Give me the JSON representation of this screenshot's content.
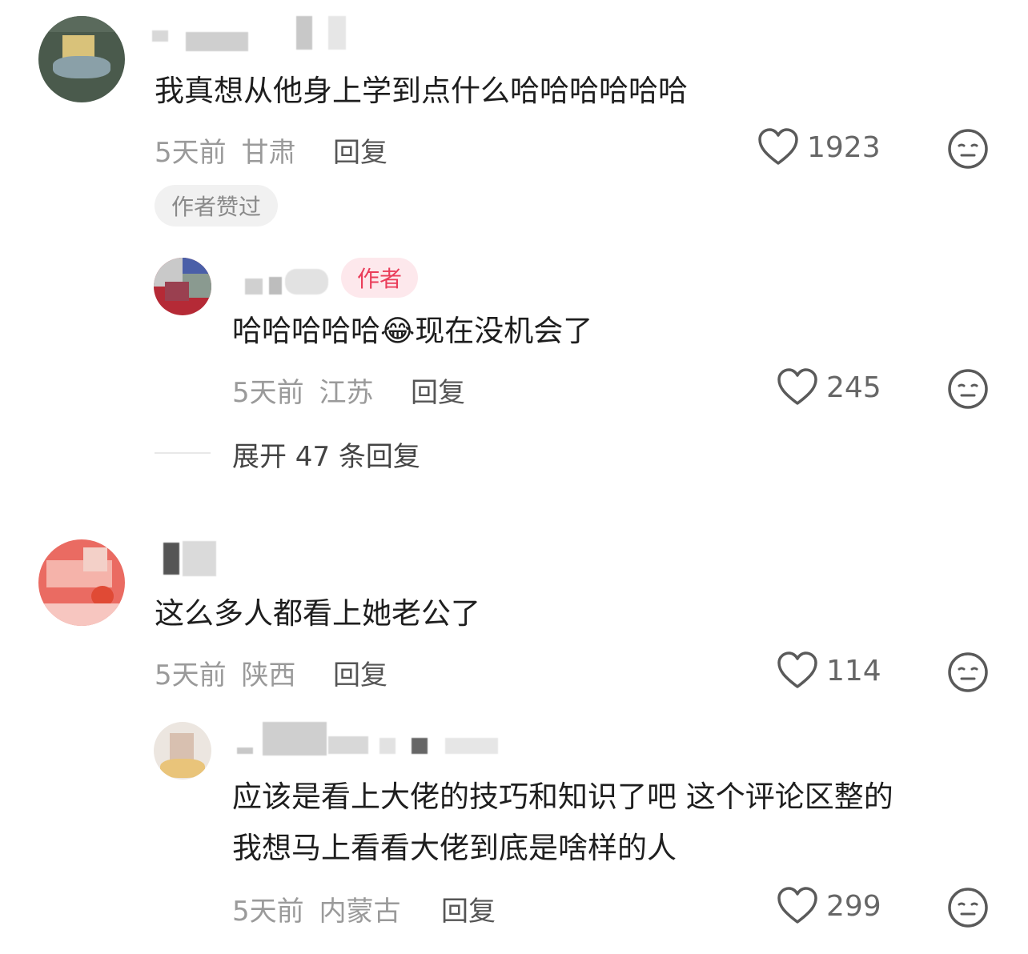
{
  "comments": [
    {
      "text": "我真想从他身上学到点什么哈哈哈哈哈哈",
      "time": "5天前",
      "location": "甘肃",
      "reply_label": "回复",
      "likes": "1923",
      "liked_badge": "作者赞过",
      "replies": [
        {
          "author_badge": "作者",
          "text": "哈哈哈哈哈😂现在没机会了",
          "time": "5天前",
          "location": "江苏",
          "reply_label": "回复",
          "likes": "245"
        }
      ],
      "expand_label": "展开 47 条回复"
    },
    {
      "text": "这么多人都看上她老公了",
      "time": "5天前",
      "location": "陕西",
      "reply_label": "回复",
      "likes": "114",
      "replies": [
        {
          "text_line1": "应该是看上大佬的技巧和知识了吧 这个评论区整的",
          "text_line2": "我想马上看看大佬到底是啥样的人",
          "time": "5天前",
          "location": "内蒙古",
          "reply_label": "回复",
          "likes": "299"
        }
      ]
    }
  ],
  "icons": {
    "like": "heart-outline-icon",
    "dislike": "meh-face-icon"
  },
  "colors": {
    "author_badge_bg": "#fde8ec",
    "author_badge_text": "#ea3d5a",
    "meta_text": "#9a9a9a"
  }
}
